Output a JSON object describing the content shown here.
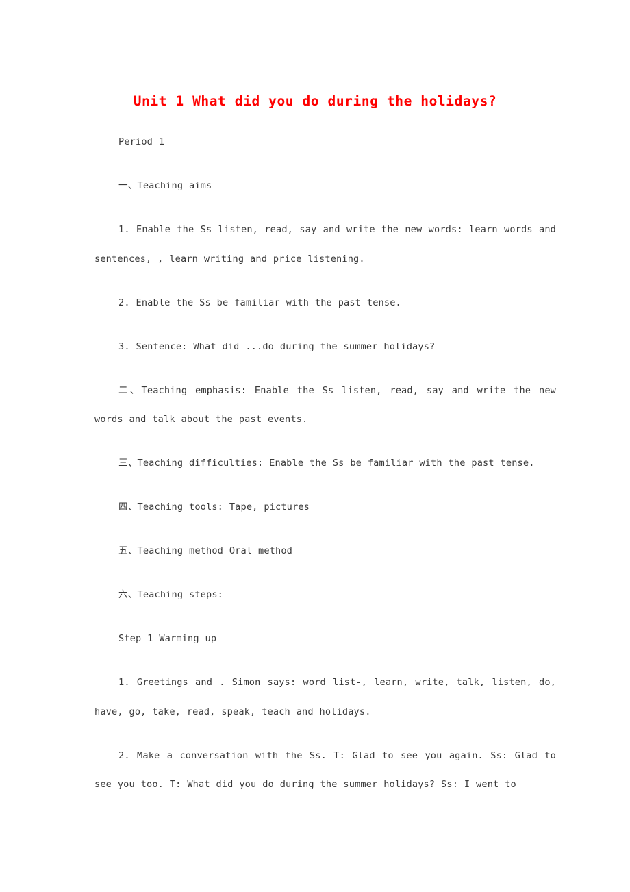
{
  "document": {
    "title": "Unit 1 What did you do during the holidays?",
    "title_color": "#fe0000",
    "body_color": "#3a3a3a",
    "background_color": "#ffffff",
    "paragraphs": [
      {
        "id": "period-label",
        "text": "Period 1",
        "indent": true,
        "wraps": false
      },
      {
        "id": "section-one-teaching-aims",
        "text": "一、Teaching aims",
        "indent": true,
        "wraps": false
      },
      {
        "id": "aim-1",
        "text": "1. Enable the Ss listen, read, say and write the new words: learn words and sentences, , learn writing and price listening.",
        "indent": true,
        "wraps": true
      },
      {
        "id": "aim-2",
        "text": "2. Enable the Ss be familiar with the past tense.",
        "indent": true,
        "wraps": false
      },
      {
        "id": "aim-3",
        "text": "3. Sentence: What did ...do during the summer holidays?",
        "indent": true,
        "wraps": false
      },
      {
        "id": "section-two-teaching-emphasis",
        "text": "二、Teaching emphasis: Enable the Ss listen, read, say and write the new words and talk about the past events.",
        "indent": true,
        "wraps": true
      },
      {
        "id": "section-three-teaching-difficulties",
        "text": "三、Teaching difficulties: Enable the Ss be familiar with the past tense.",
        "indent": true,
        "wraps": false
      },
      {
        "id": "section-four-teaching-tools",
        "text": "四、Teaching tools: Tape, pictures",
        "indent": true,
        "wraps": false
      },
      {
        "id": "section-five-teaching-method",
        "text": "五、Teaching method Oral method",
        "indent": true,
        "wraps": false
      },
      {
        "id": "section-six-teaching-steps",
        "text": "六、Teaching steps:",
        "indent": true,
        "wraps": false
      },
      {
        "id": "step-1-warming-up",
        "text": "Step 1 Warming up",
        "indent": true,
        "wraps": false
      },
      {
        "id": "step-1-item-1",
        "text": "1. Greetings and . Simon says: word list-, learn, write, talk, listen, do, have, go, take, read, speak, teach and holidays.",
        "indent": true,
        "wraps": true
      },
      {
        "id": "step-1-item-2",
        "text": "2. Make a conversation with the Ss. T: Glad to see you again. Ss: Glad to see you too. T: What did you do during the summer holidays? Ss: I went to",
        "indent": true,
        "wraps": true
      }
    ]
  }
}
